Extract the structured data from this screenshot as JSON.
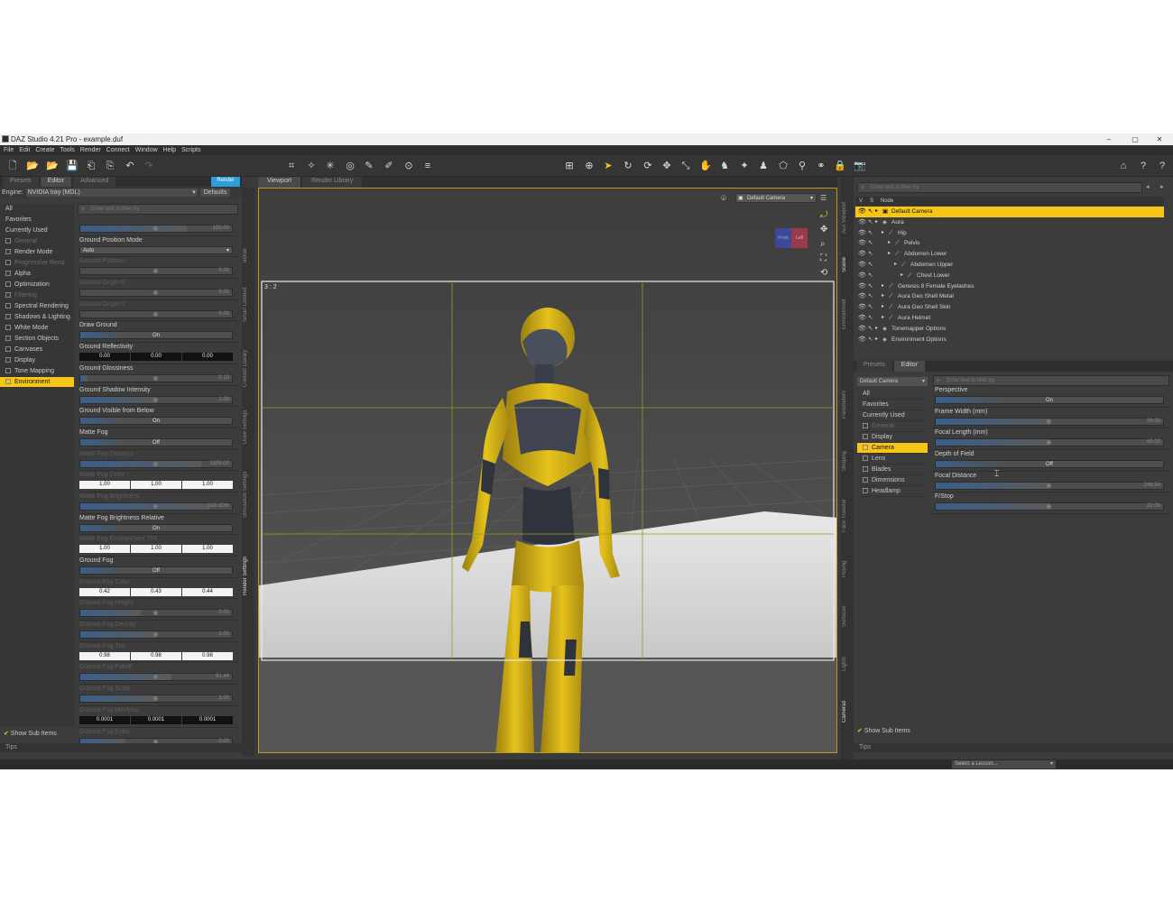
{
  "window": {
    "title": "DAZ Studio 4.21 Pro - example.duf",
    "min": "–",
    "max": "▢",
    "close": "✕"
  },
  "menu": [
    "File",
    "Edit",
    "Create",
    "Tools",
    "Render",
    "Connect",
    "Window",
    "Help",
    "Scripts"
  ],
  "left_panel": {
    "tabs": [
      "Presets",
      "Editor",
      "Advanced"
    ],
    "render_button": "Render",
    "engine_label": "Engine:",
    "engine_value": "NVIDIA Iray (MDL)",
    "defaults_button": "Defaults",
    "search_placeholder": "Enter text to filter by",
    "categories": [
      {
        "label": "All",
        "state": "normal"
      },
      {
        "label": "Favorites",
        "state": "normal"
      },
      {
        "label": "Currently Used",
        "state": "normal"
      },
      {
        "label": "General",
        "state": "dim"
      },
      {
        "label": "Render Mode",
        "state": "normal"
      },
      {
        "label": "Progressive Rend",
        "state": "dim"
      },
      {
        "label": "Alpha",
        "state": "normal"
      },
      {
        "label": "Optimization",
        "state": "normal"
      },
      {
        "label": "Filtering",
        "state": "dim"
      },
      {
        "label": "Spectral Rendering",
        "state": "normal"
      },
      {
        "label": "Shadows & Lighting",
        "state": "normal"
      },
      {
        "label": "White Mode",
        "state": "normal"
      },
      {
        "label": "Section Objects",
        "state": "normal"
      },
      {
        "label": "Canvases",
        "state": "normal"
      },
      {
        "label": "Display",
        "state": "normal"
      },
      {
        "label": "Tone Mapping",
        "state": "normal"
      },
      {
        "label": "Environment",
        "state": "selected"
      }
    ],
    "properties": [
      {
        "type": "slider",
        "label": "",
        "dim": true,
        "value": "100.00",
        "fill": 0.7
      },
      {
        "type": "dropdown",
        "label": "Ground Position Mode",
        "value": "Auto"
      },
      {
        "type": "slider",
        "label": "Ground Position",
        "dim": true,
        "value": "0.00",
        "fill": 0.0
      },
      {
        "type": "slider",
        "label": "Ground Origin X",
        "dim": true,
        "value": "0.00",
        "fill": 0.0
      },
      {
        "type": "slider",
        "label": "Ground Origin Y",
        "dim": true,
        "value": "0.00",
        "fill": 0.0
      },
      {
        "type": "toggle",
        "label": "Draw Ground",
        "value": "On"
      },
      {
        "type": "triple_dark",
        "label": "Ground Reflectivity",
        "values": [
          "0.00",
          "0.00",
          "0.00"
        ]
      },
      {
        "type": "slider",
        "label": "Ground Glossiness",
        "dim": false,
        "value": "0.10",
        "fill": 0.05
      },
      {
        "type": "slider",
        "label": "Ground Shadow Intensity",
        "dim": false,
        "value": "1.00",
        "fill": 0.5
      },
      {
        "type": "toggle",
        "label": "Ground Visible from Below",
        "value": "On"
      },
      {
        "type": "toggle",
        "label": "Matte Fog",
        "value": "Off"
      },
      {
        "type": "slider",
        "label": "Matte Fog Distance",
        "dim": true,
        "value": "1925.00",
        "fill": 0.8
      },
      {
        "type": "triple",
        "label": "Matte Fog Color",
        "dim": true,
        "values": [
          "1.00",
          "1.00",
          "1.00"
        ]
      },
      {
        "type": "slider",
        "label": "Matte Fog Brightness",
        "dim": true,
        "value": "100.00%",
        "fill": 0.85
      },
      {
        "type": "toggle",
        "label": "Matte Fog Brightness Relative",
        "value": "On"
      },
      {
        "type": "triple",
        "label": "Matte Fog Environment Tint",
        "dim": true,
        "values": [
          "1.00",
          "1.00",
          "1.00"
        ]
      },
      {
        "type": "toggle",
        "label": "Ground Fog",
        "value": "Off"
      },
      {
        "type": "triple",
        "label": "Ground Fog Color",
        "dim": true,
        "values": [
          "0.42",
          "0.43",
          "0.44"
        ]
      },
      {
        "type": "slider",
        "label": "Ground Fog Height",
        "dim": true,
        "value": "0.00",
        "fill": 0.4
      },
      {
        "type": "slider",
        "label": "Ground Fog Density",
        "dim": true,
        "value": "1.00",
        "fill": 0.5
      },
      {
        "type": "triple",
        "label": "Ground Fog Tint",
        "dim": true,
        "values": [
          "0.98",
          "0.98",
          "0.98"
        ]
      },
      {
        "type": "slider",
        "label": "Ground Fog Falloff",
        "dim": true,
        "value": "91.44",
        "fill": 0.6
      },
      {
        "type": "slider",
        "label": "Ground Fog Scale",
        "dim": true,
        "value": "1.00",
        "fill": 0.5
      },
      {
        "type": "triple_dark",
        "label": "Ground Fog Min/Max",
        "dim": true,
        "values": [
          "0.0001",
          "0.0001",
          "0.0001"
        ]
      },
      {
        "type": "slider",
        "label": "Ground Fog Extra",
        "dim": true,
        "value": "0.00",
        "fill": 0.3
      }
    ],
    "show_sub_items": "Show Sub Items",
    "tips": "Tips",
    "side_tabs": [
      "Render Settings",
      "Simulation Settings",
      "Draw Settings",
      "Content Library",
      "Smart Content",
      "Install"
    ]
  },
  "viewport": {
    "tabs": [
      "Viewport",
      "Render Library"
    ],
    "camera_select": "Default Camera",
    "aspect_label": "3 : 2",
    "cube_labels": [
      "Front",
      "Left"
    ]
  },
  "scene": {
    "search_placeholder": "Enter text to filter by",
    "header_cols": [
      "V",
      "S",
      "Node"
    ],
    "nodes": [
      {
        "label": "Default Camera",
        "depth": 0,
        "sel": true
      },
      {
        "label": "Aura",
        "depth": 0,
        "sel": false
      },
      {
        "label": "Hip",
        "depth": 1,
        "sel": false
      },
      {
        "label": "Pelvis",
        "depth": 2,
        "sel": false
      },
      {
        "label": "Abdomen Lower",
        "depth": 2,
        "sel": false
      },
      {
        "label": "Abdomen Upper",
        "depth": 3,
        "sel": false
      },
      {
        "label": "Chest Lower",
        "depth": 4,
        "sel": false
      },
      {
        "label": "Genesis 8 Female Eyelashes",
        "depth": 1,
        "sel": false
      },
      {
        "label": "Aura Geo Shell Metal",
        "depth": 1,
        "sel": false
      },
      {
        "label": "Aura Geo Shell Skin",
        "depth": 1,
        "sel": false
      },
      {
        "label": "Aura Helmet",
        "depth": 1,
        "sel": false
      },
      {
        "label": "Tonemapper Options",
        "depth": 0,
        "sel": false
      },
      {
        "label": "Environment Options",
        "depth": 0,
        "sel": false
      }
    ],
    "side_tabs": [
      "Scene",
      "Environment",
      "Aux Viewport"
    ]
  },
  "params": {
    "tabs": [
      "Presets",
      "Editor"
    ],
    "node_select": "Default Camera",
    "search_placeholder": "Enter text to filter by",
    "categories": [
      {
        "label": "All",
        "state": "normal"
      },
      {
        "label": "Favorites",
        "state": "normal"
      },
      {
        "label": "Currently Used",
        "state": "normal"
      },
      {
        "label": "General",
        "state": "dim"
      },
      {
        "label": "Display",
        "state": "normal"
      },
      {
        "label": "Camera",
        "state": "selected"
      },
      {
        "label": "Lens",
        "state": "normal"
      },
      {
        "label": "Blades",
        "state": "normal"
      },
      {
        "label": "Dimensions",
        "state": "normal"
      },
      {
        "label": "Headlamp",
        "state": "normal"
      }
    ],
    "properties": [
      {
        "type": "toggle",
        "label": "Perspective",
        "value": "On"
      },
      {
        "type": "slider",
        "label": "Frame Width (mm)",
        "dim": false,
        "value": "36.00",
        "fill": 0.5
      },
      {
        "type": "slider",
        "label": "Focal Length (mm)",
        "dim": false,
        "value": "65.00",
        "fill": 0.5
      },
      {
        "type": "toggle",
        "label": "Depth of Field",
        "value": "Off"
      },
      {
        "type": "slider",
        "label": "Focal Distance",
        "dim": false,
        "value": "246.54",
        "fill": 0.5
      },
      {
        "type": "slider",
        "label": "F/Stop",
        "dim": false,
        "value": "22.00",
        "fill": 0.5
      }
    ],
    "show_sub_items": "Show Sub Items",
    "tips": "Tips",
    "side_tabs": [
      "Parameters",
      "Shaping",
      "Face Transfer",
      "Posing",
      "Surfaces",
      "Lights",
      "Cameras"
    ]
  },
  "status": {
    "lesson_select": "Select a Lesson..."
  }
}
